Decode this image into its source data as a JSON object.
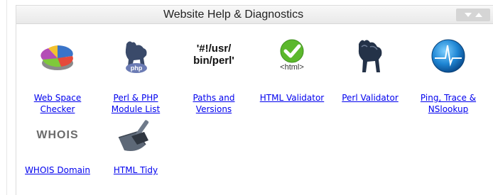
{
  "panel": {
    "title": "Website Help & Diagnostics",
    "collapse_icon": "chevron-down-icon",
    "expand_icon": "chevron-up-icon"
  },
  "items": [
    {
      "label_line1": "Web Space",
      "label_line2": "Checker",
      "icon": "pie-chart-icon"
    },
    {
      "label_line1": "Perl & PHP",
      "label_line2": "Module List",
      "icon": "php-camel-icon"
    },
    {
      "label_line1": "Paths and",
      "label_line2": "Versions",
      "icon": "perl-path-text-icon",
      "icon_text_line1": "'#!/usr/",
      "icon_text_line2": "bin/perl'"
    },
    {
      "label_line1": "HTML Validator",
      "icon": "html-check-icon",
      "icon_text": "<html>"
    },
    {
      "label_line1": "Perl Validator",
      "icon": "camel-icon"
    },
    {
      "label_line1": "Ping, Trace &",
      "label_line2": "NSlookup",
      "icon": "pulse-monitor-icon"
    },
    {
      "label_line1": "WHOIS Domain",
      "icon": "whois-text-icon",
      "icon_text": "WHOIS"
    },
    {
      "label_line1": "HTML Tidy",
      "icon": "dustpan-brush-icon"
    }
  ]
}
